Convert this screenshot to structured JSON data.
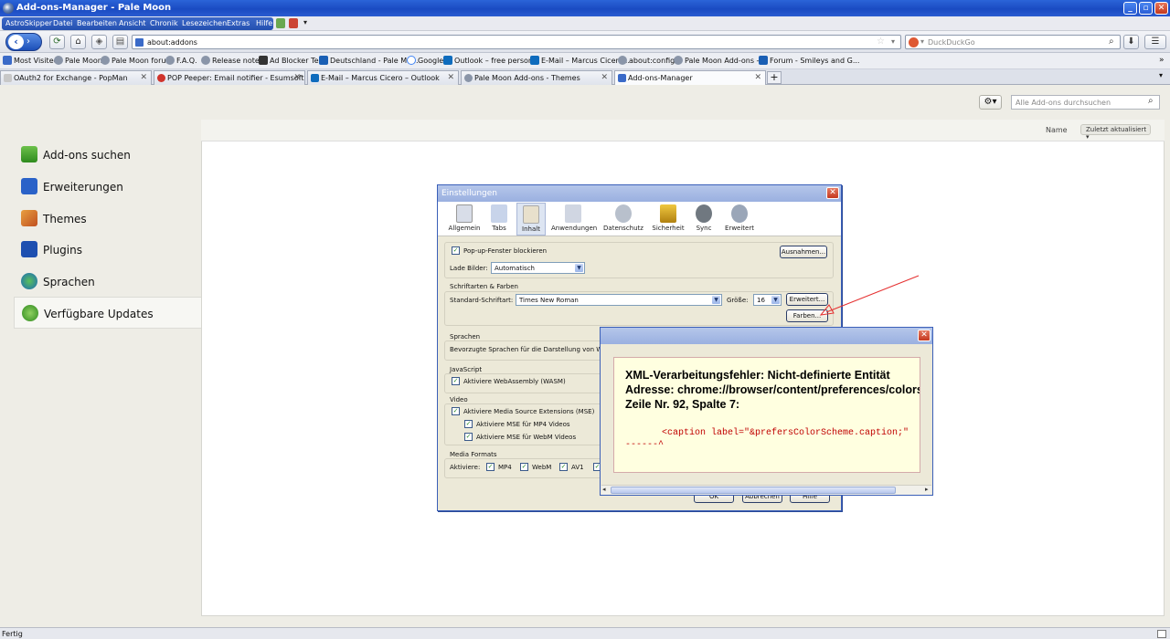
{
  "window": {
    "title": "Add-ons-Manager - Pale Moon"
  },
  "menu": {
    "astroskipper": "AstroSkipper",
    "items": [
      "Datei",
      "Bearbeiten",
      "Ansicht",
      "Chronik",
      "Lesezeichen",
      "Extras",
      "Hilfe"
    ]
  },
  "nav": {
    "url": "about:addons",
    "search_placeholder": "DuckDuckGo"
  },
  "bookmarks": [
    "Most Visited",
    "Pale Moon",
    "Pale Moon forum",
    "F.A.Q.",
    "Release notes",
    "Ad Blocker Test",
    "Deutschland - Pale Mo...",
    "Google",
    "Outlook – free person...",
    "E-Mail – Marcus Cicero...",
    "about:config",
    "Pale Moon Add-ons - ...",
    "Forum - Smileys and G..."
  ],
  "tabs": [
    {
      "label": "OAuth2 for Exchange - PopMan",
      "active": false
    },
    {
      "label": "POP Peeper: Email notifier - Esumsoft",
      "active": false
    },
    {
      "label": "E-Mail – Marcus Cicero – Outlook",
      "active": false
    },
    {
      "label": "Pale Moon Add-ons - Themes",
      "active": false
    },
    {
      "label": "Add-ons-Manager",
      "active": true
    }
  ],
  "addons": {
    "search_placeholder": "Alle Add-ons durchsuchen",
    "sort_name": "Name",
    "sort_updated": "Zuletzt aktualisiert",
    "categories": [
      {
        "label": "Add-ons suchen",
        "icon": "download-icon"
      },
      {
        "label": "Erweiterungen",
        "icon": "puzzle-icon"
      },
      {
        "label": "Themes",
        "icon": "brush-icon"
      },
      {
        "label": "Plugins",
        "icon": "lego-icon"
      },
      {
        "label": "Sprachen",
        "icon": "globe-icon"
      },
      {
        "label": "Verfügbare Updates",
        "icon": "update-icon",
        "selected": true
      }
    ]
  },
  "settings": {
    "title": "Einstellungen",
    "panes": [
      "Allgemein",
      "Tabs",
      "Inhalt",
      "Anwendungen",
      "Datenschutz",
      "Sicherheit",
      "Sync",
      "Erweitert"
    ],
    "selected_pane": "Inhalt",
    "popup_block": "Pop-up-Fenster blockieren",
    "exceptions": "Ausnahmen...",
    "load_images_label": "Lade Bilder:",
    "load_images_value": "Automatisch",
    "fonts_group": "Schriftarten & Farben",
    "default_font_label": "Standard-Schriftart:",
    "default_font_value": "Times New Roman",
    "size_label": "Größe:",
    "size_value": "16",
    "advanced_btn": "Erweitert...",
    "colors_btn": "Farben...",
    "languages_group": "Sprachen",
    "languages_desc": "Bevorzugte Sprachen für die Darstellung von Webs",
    "javascript_group": "JavaScript",
    "wasm": "Aktiviere WebAssembly (WASM)",
    "video_group": "Video",
    "mse": "Aktiviere Media Source Extensions (MSE)",
    "mse_mp4": "Aktiviere MSE für MP4 Videos",
    "mse_webm": "Aktiviere MSE für WebM Videos",
    "media_group": "Media Formats",
    "activate_label": "Aktiviere:",
    "formats": [
      "MP4",
      "WebM",
      "AV1"
    ],
    "ok": "OK",
    "cancel": "Abbrechen",
    "help": "Hilfe"
  },
  "error": {
    "line1": "XML-Verarbeitungsfehler: Nicht-definierte Entität",
    "line2": "Adresse: chrome://browser/content/preferences/colors",
    "line3": "Zeile Nr. 92, Spalte 7:",
    "code1": "<caption label=\"&prefersColorScheme.caption;\"",
    "code2": "------^"
  },
  "status": {
    "text": "Fertig"
  }
}
